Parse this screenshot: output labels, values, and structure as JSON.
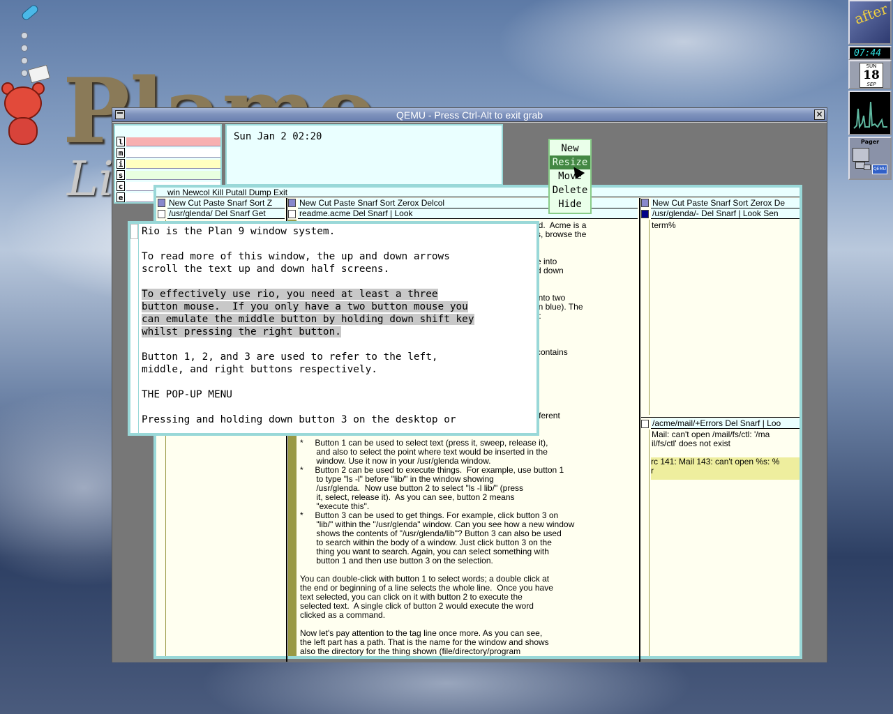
{
  "desktop": {
    "logo_text": "Plamo",
    "logo_sub": "Li",
    "dock": {
      "clock": "07:44",
      "calendar": {
        "dow": "SUN",
        "day": "18",
        "month": "SEP"
      },
      "pager_title": "Pager",
      "pager_app": "QEMU"
    }
  },
  "qemu": {
    "title": "QEMU - Press Ctrl-Alt to exit grab"
  },
  "stats": {
    "rows": [
      {
        "key": "l",
        "color": "#f7b0b0"
      },
      {
        "key": "m",
        "color": "#ffffff"
      },
      {
        "key": "i",
        "color": "#ffffc0"
      },
      {
        "key": "s",
        "color": "#e8ffe0"
      },
      {
        "key": "c",
        "color": "#ffffff"
      },
      {
        "key": "e",
        "color": "#ffffff"
      }
    ]
  },
  "clockwin": {
    "time": "Sun Jan  2 02:20"
  },
  "popup_menu": {
    "items": [
      "New",
      "Resize",
      "Move",
      "Delete",
      "Hide"
    ],
    "selected": "Resize"
  },
  "acme": {
    "main_tag": "win Newcol Kill Putall Dump Exit",
    "col1_tag": "New Cut Paste Snarf Sort Z",
    "col2_tag": "New Cut Paste Snarf Sort Zerox Delcol",
    "col3_tag": "New Cut Paste Snarf Sort Zerox De",
    "win1_tag": "/usr/glenda/ Del Snarf Get",
    "win2_tag": "readme.acme Del Snarf | Look",
    "win3_tag": "/usr/glenda/- Del Snarf | Look Sen",
    "win3_body": "term%",
    "win4_tag": "/acme/mail/+Errors Del Snarf | Loo",
    "win4_body": "Mail: can't open /mail/fs/ctl: '/ma\nil/fs/ctl' does not exist",
    "win4_body2": "rc 141: Mail 143: can't open %s: %\nr",
    "readme_fragments": [
      "id.  Acme is a",
      "s, browse the",
      "e into",
      "d down",
      "into two",
      "in blue). The",
      "t:",
      "contains",
      "fferent"
    ],
    "readme_body": "*     Button 1 can be used to select text (press it, sweep, release it),\n       and also to select the point where text would be inserted in the\n       window. Use it now in your /usr/glenda window.\n*     Button 2 can be used to execute things.  For example, use button 1\n       to type \"ls -l\" before \"lib/\" in the window showing\n       /usr/glenda.  Now use button 2 to select \"ls -l lib/\" (press\n       it, select, release it).  As you can see, button 2 means\n       \"execute this\".\n*     Button 3 can be used to get things. For example, click button 3 on\n       \"lib/\" within the \"/usr/glenda\" window. Can you see how a new window\n       shows the contents of \"/usr/glenda/lib\"? Button 3 can also be used\n       to search within the body of a window. Just click button 3 on the\n       thing you want to search. Again, you can select something with\n       button 1 and then use button 3 on the selection.\n\nYou can double-click with button 1 to select words; a double click at\nthe end or beginning of a line selects the whole line.  Once you have\ntext selected, you can click on it with button 2 to execute the\nselected text.  A single click of button 2 would execute the word\nclicked as a command.\n\nNow let's pay attention to the tag line once more. As you can see,\nthe left part has a path. That is the name for the window and shows\nalso the directory for the thing shown (file/directory/program"
  },
  "rio": {
    "text_before": "Rio is the Plan 9 window system.\n\nTo read more of this window, the up and down arrows\nscroll the text up and down half screens.\n\n",
    "text_selected": "To effectively use rio, you need at least a three\nbutton mouse.  If you only have a two button mouse you\ncan emulate the middle button by holding down shift key\nwhilst pressing the right button.",
    "text_after": "\n\nButton 1, 2, and 3 are used to refer to the left,\nmiddle, and right buttons respectively.\n\nTHE POP-UP MENU\n\nPressing and holding down button 3 on the desktop or"
  }
}
